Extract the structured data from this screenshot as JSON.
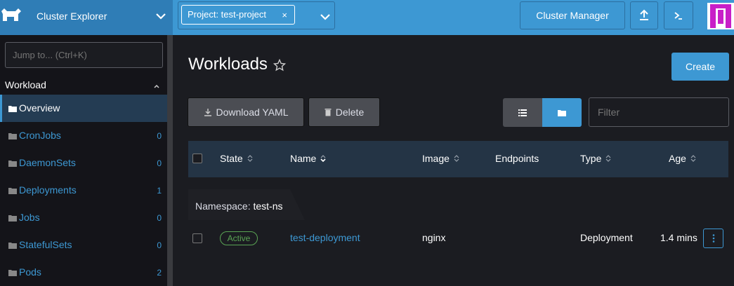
{
  "header": {
    "cluster_name": "Cluster Explorer",
    "project_chip": "Project: test-project",
    "chip_close": "×",
    "cluster_manager": "Cluster Manager",
    "accent": "#3d98d3"
  },
  "sidebar": {
    "jump_placeholder": "Jump to... (Ctrl+K)",
    "group": "Workload",
    "items": [
      {
        "label": "Overview",
        "count": ""
      },
      {
        "label": "CronJobs",
        "count": "0"
      },
      {
        "label": "DaemonSets",
        "count": "0"
      },
      {
        "label": "Deployments",
        "count": "1"
      },
      {
        "label": "Jobs",
        "count": "0"
      },
      {
        "label": "StatefulSets",
        "count": "0"
      },
      {
        "label": "Pods",
        "count": "2"
      }
    ]
  },
  "main": {
    "title": "Workloads",
    "create": "Create",
    "download_yaml": "Download YAML",
    "delete": "Delete",
    "filter_placeholder": "Filter",
    "columns": [
      "State",
      "Name",
      "Image",
      "Endpoints",
      "Type",
      "Age"
    ],
    "namespace_label": "Namespace:",
    "namespace": "test-ns",
    "rows": [
      {
        "state": "Active",
        "name": "test-deployment",
        "image": "nginx",
        "endpoints": "",
        "type": "Deployment",
        "age": "1.4 mins"
      }
    ]
  }
}
